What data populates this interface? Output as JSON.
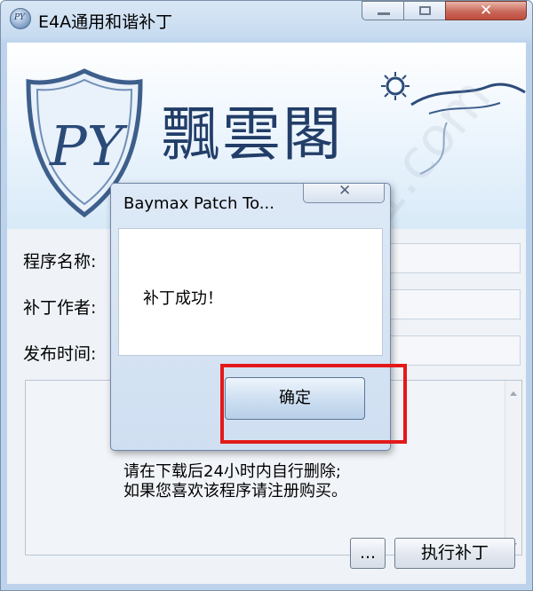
{
  "window": {
    "title": "E4A通用和谐补丁",
    "controls": [
      "minimize",
      "maximize",
      "close"
    ]
  },
  "banner": {
    "logo_text": "PY",
    "brand_text": "飄雲閣"
  },
  "fields": [
    {
      "label": "程序名称:",
      "value": ""
    },
    {
      "label": "补丁作者:",
      "value": ""
    },
    {
      "label": "发布时间:",
      "value": ""
    }
  ],
  "notes": {
    "line1": "请在下载后24小时内自行删除;",
    "line2": "如果您喜欢该程序请注册购买。"
  },
  "buttons": {
    "browse": "...",
    "patch": "执行补丁"
  },
  "dialog": {
    "title": "Baymax Patch To...",
    "message": "补丁成功！",
    "ok": "确定"
  },
  "watermark": "软件 xue51.com",
  "colors": {
    "highlight": "#e3191a",
    "brand": "#223e68",
    "close_button": "#c8685a"
  }
}
